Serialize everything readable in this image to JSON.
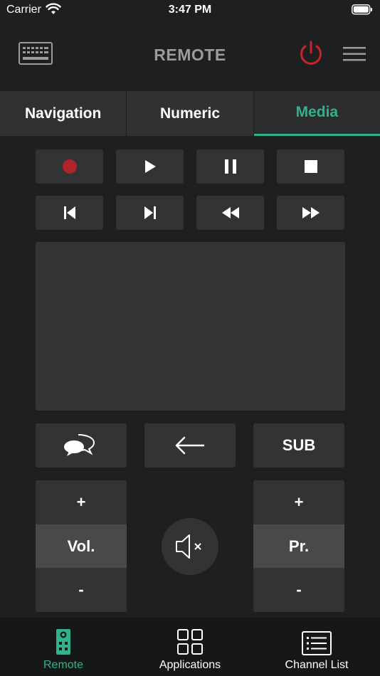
{
  "status_bar": {
    "carrier": "Carrier",
    "time": "3:47 PM"
  },
  "header": {
    "title": "REMOTE",
    "power_color": "#c8232c"
  },
  "tabs": [
    {
      "label": "Navigation",
      "active": false
    },
    {
      "label": "Numeric",
      "active": false
    },
    {
      "label": "Media",
      "active": true
    }
  ],
  "media_buttons": {
    "row1": [
      "record-icon",
      "play-icon",
      "pause-icon",
      "stop-icon"
    ],
    "row2": [
      "skip-previous-icon",
      "skip-next-icon",
      "rewind-icon",
      "fast-forward-icon"
    ],
    "record_color": "#b0232b"
  },
  "function_buttons": {
    "chat_icon": "chat-bubbles-icon",
    "back_icon": "back-arrow-icon",
    "sub_label": "SUB"
  },
  "volume": {
    "plus": "+",
    "label": "Vol.",
    "minus": "-"
  },
  "program": {
    "plus": "+",
    "label": "Pr.",
    "minus": "-"
  },
  "mute_icon": "mute-icon",
  "bottom_nav": [
    {
      "label": "Remote",
      "icon": "remote-icon",
      "active": true
    },
    {
      "label": "Applications",
      "icon": "apps-grid-icon",
      "active": false
    },
    {
      "label": "Channel List",
      "icon": "channel-list-icon",
      "active": false
    }
  ],
  "colors": {
    "accent": "#2eb38a",
    "background": "#1e1f21",
    "button": "#323335"
  }
}
